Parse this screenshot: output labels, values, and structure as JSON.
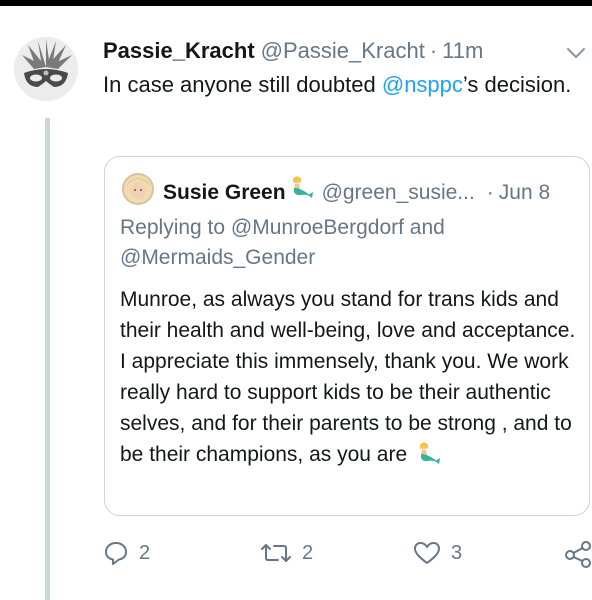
{
  "tweet": {
    "display_name": "Passie_Kracht",
    "handle": "@Passie_Kracht",
    "separator": "·",
    "time": "11m",
    "text_before": "In case anyone still doubted ",
    "mention": "@nsppc",
    "text_after": "’s decision."
  },
  "quoted_tweet": {
    "display_name": "Susie Green",
    "handle": "@green_susie...",
    "separator": "·",
    "date": "Jun 8",
    "reply_prefix": "Replying to ",
    "reply_targets": "@MunroeBergdorf and @Mermaids_Gender",
    "body": "Munroe, as always you stand for trans kids and their health and well-being, love and acceptance. I appreciate this immensely, thank you. We work really hard to support kids to be their authentic selves, and for their parents to be strong , and to be their champions, as you are"
  },
  "actions": {
    "replies": "2",
    "retweets": "2",
    "likes": "3"
  },
  "icons": {
    "more": "chevron-down-icon",
    "reply": "reply-icon",
    "retweet": "retweet-icon",
    "like": "heart-icon",
    "share": "share-icon",
    "emoji": "mermaid-emoji"
  },
  "colors": {
    "link": "#1da1f2",
    "secondary": "#657786",
    "border": "#ccd6dd",
    "text": "#14171a"
  }
}
